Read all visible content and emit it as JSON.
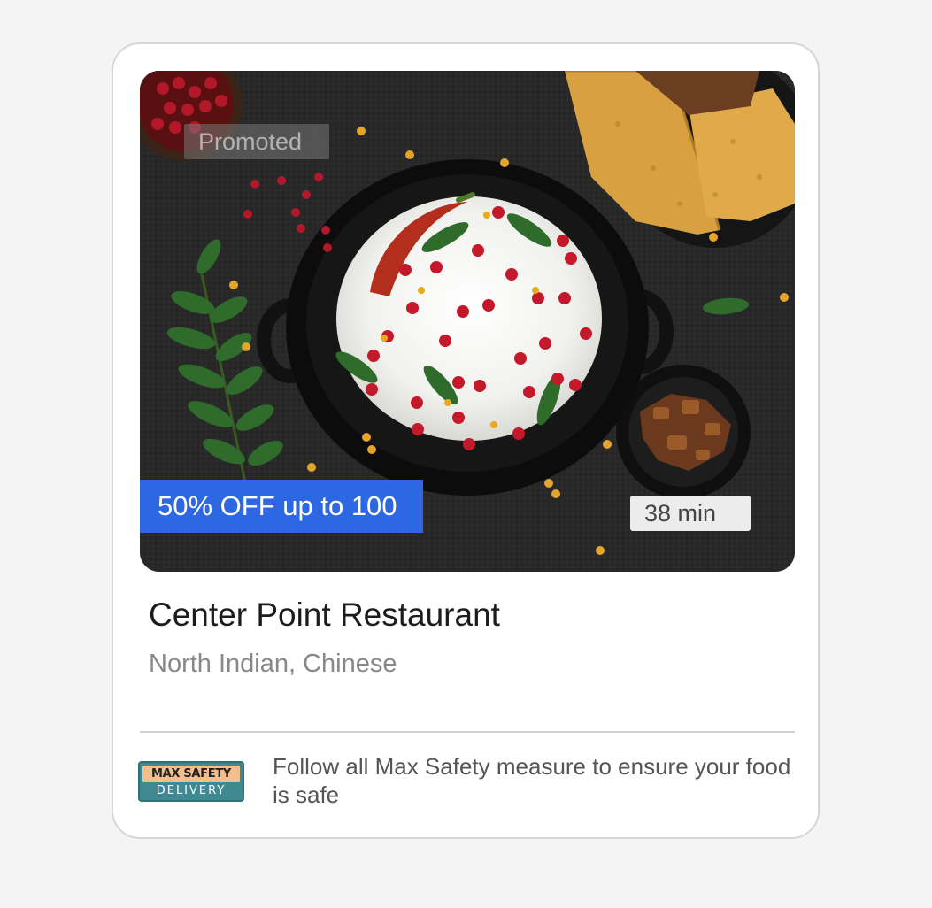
{
  "card": {
    "promoted_label": "Promoted",
    "offer": "50% OFF up to 100",
    "delivery_time": "38 min",
    "restaurant_name": "Center Point Restaurant",
    "cuisines": "North Indian, Chinese",
    "safety": {
      "badge_top": "MAX SAFETY",
      "badge_bottom": "DELIVERY",
      "message": "Follow all Max Safety measure to ensure your food is safe"
    }
  },
  "colors": {
    "offer_bg": "#2e67e2",
    "badge_teal": "#3f8a92",
    "badge_peach": "#f2be8e"
  },
  "icons": {
    "food_image": "curd-rice-dish-photo"
  }
}
